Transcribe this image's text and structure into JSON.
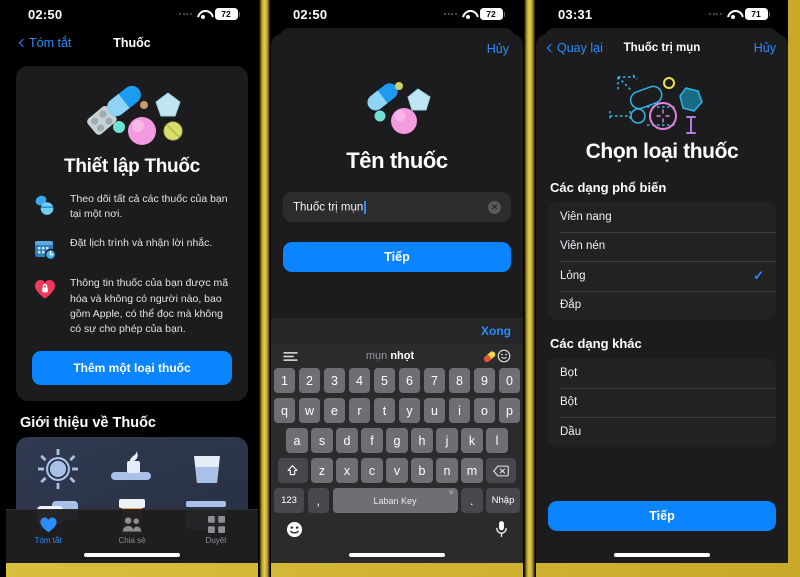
{
  "theme": {
    "accent_blue": "#0b84ff",
    "link_blue": "#2b8cfb",
    "sheet_bg": "#1c1c1e",
    "frame_gold": "#c9a227"
  },
  "panel1": {
    "statusbar": {
      "time": "02:50",
      "battery": "72",
      "wifi_icon": "wifi-icon",
      "cellular_icon": "cellular-dots-icon"
    },
    "nav": {
      "back_label": "Tóm tắt",
      "title": "Thuốc",
      "back_icon": "chevron-left-icon"
    },
    "card": {
      "hero_icon": "pills-illustration",
      "title": "Thiết lập Thuốc",
      "features": [
        {
          "icon": "pills-icon",
          "text": "Theo dõi tất cả các thuốc của bạn tại một nơi."
        },
        {
          "icon": "calendar-clock-icon",
          "text": "Đặt lịch trình và nhận lời nhắc."
        },
        {
          "icon": "heart-lock-icon",
          "text": "Thông tin thuốc của bạn được mã hóa và không có người nào, bao gồm Apple, có thể đọc mà không có sự cho phép của bạn."
        }
      ],
      "cta_label": "Thêm một loại thuốc"
    },
    "section_title": "Giới thiệu về Thuốc",
    "promo_icons": [
      "sun-icon",
      "toothbrush-icon",
      "water-glass-icon",
      "chat-bubbles-icon",
      "pill-bottle-icon",
      "card-icon"
    ],
    "tabs": [
      {
        "label": "Tóm tắt",
        "icon": "heart-icon",
        "active": true
      },
      {
        "label": "Chia sẻ",
        "icon": "people-icon",
        "active": false
      },
      {
        "label": "Duyệt",
        "icon": "grid-icon",
        "active": false
      }
    ]
  },
  "panel2": {
    "statusbar": {
      "time": "02:50",
      "battery": "72"
    },
    "sheet": {
      "cancel_label": "Hủy",
      "hero_icon": "pills-illustration-small",
      "title": "Tên thuốc",
      "input": {
        "value": "Thuốc trị mụn",
        "placeholder": "Tên thuốc",
        "clear_icon": "clear-circle-icon"
      },
      "next_label": "Tiếp"
    },
    "keyboard_accessory": {
      "done_label": "Xong"
    },
    "keyboard": {
      "suggestion_left_icon": "list-lines-icon",
      "suggestion_dim": "mụn",
      "suggestion_bright": "nhọt",
      "suggestion_emoji_pill": "pill-emoji",
      "suggestion_emoji_face": "smiley-outline-icon",
      "row_numbers": [
        "1",
        "2",
        "3",
        "4",
        "5",
        "6",
        "7",
        "8",
        "9",
        "0"
      ],
      "row1": [
        "q",
        "w",
        "e",
        "r",
        "t",
        "y",
        "u",
        "i",
        "o",
        "p"
      ],
      "row2": [
        "a",
        "s",
        "d",
        "f",
        "g",
        "h",
        "j",
        "k",
        "l"
      ],
      "row3": [
        "z",
        "x",
        "c",
        "v",
        "b",
        "n",
        "m"
      ],
      "shift_icon": "shift-icon",
      "backspace_icon": "backspace-icon",
      "numeric_label": "123",
      "comma_label": ",",
      "space_label": "Laban Key",
      "space_lang": "vi",
      "period_label": ".",
      "enter_label": "Nhập",
      "emoji_icon": "emoji-face-icon",
      "mic_icon": "microphone-icon"
    }
  },
  "panel3": {
    "statusbar": {
      "time": "03:31",
      "battery": "71"
    },
    "nav": {
      "back_label": "Quay lại",
      "title": "Thuốc trị mụn",
      "cancel_label": "Hủy",
      "back_icon": "chevron-left-icon"
    },
    "hero_icon": "medication-shapes-outline-illustration",
    "title": "Chọn loại thuốc",
    "groups": [
      {
        "heading": "Các dạng phổ biến",
        "items": [
          {
            "label": "Viên nang",
            "selected": false
          },
          {
            "label": "Viên nén",
            "selected": false
          },
          {
            "label": "Lỏng",
            "selected": true
          },
          {
            "label": "Đắp",
            "selected": false
          }
        ],
        "check_icon": "checkmark-icon"
      },
      {
        "heading": "Các dạng khác",
        "items": [
          {
            "label": "Bọt",
            "selected": false
          },
          {
            "label": "Bột",
            "selected": false
          },
          {
            "label": "Dầu",
            "selected": false
          }
        ]
      }
    ],
    "next_label": "Tiếp"
  }
}
